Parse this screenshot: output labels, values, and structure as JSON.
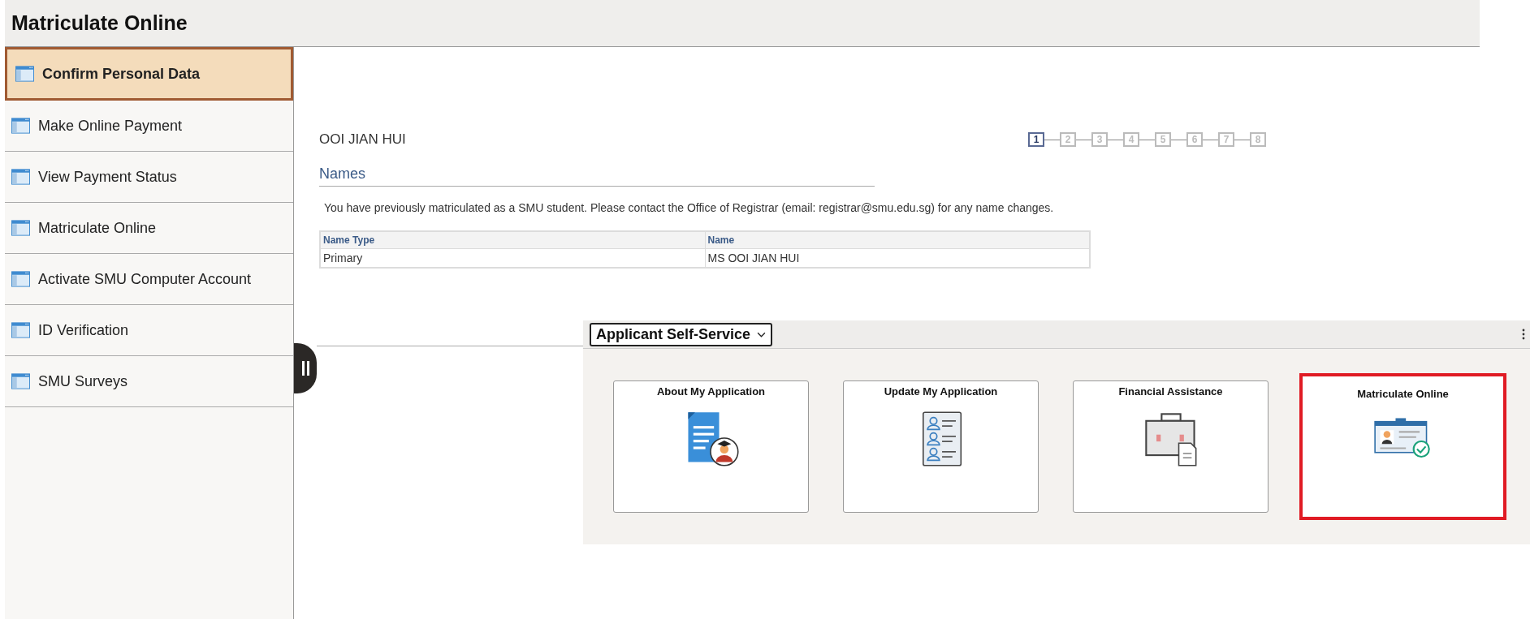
{
  "header": {
    "title": "Matriculate Online"
  },
  "sidebar": {
    "items": [
      {
        "label": "Confirm Personal Data",
        "selected": true
      },
      {
        "label": "Make Online Payment",
        "selected": false
      },
      {
        "label": "View Payment Status",
        "selected": false
      },
      {
        "label": "Matriculate Online",
        "selected": false
      },
      {
        "label": "Activate SMU Computer Account",
        "selected": false
      },
      {
        "label": "ID Verification",
        "selected": false
      },
      {
        "label": "SMU Surveys",
        "selected": false
      }
    ]
  },
  "student_name": "OOI JIAN HUI",
  "steps": [
    {
      "label": "1",
      "selected": true
    },
    {
      "label": "2",
      "selected": false
    },
    {
      "label": "3",
      "selected": false
    },
    {
      "label": "4",
      "selected": false
    },
    {
      "label": "5",
      "selected": false
    },
    {
      "label": "6",
      "selected": false
    },
    {
      "label": "7",
      "selected": false
    },
    {
      "label": "8",
      "selected": false
    }
  ],
  "section_title": "Names",
  "notice": "You have previously matriculated as a SMU student.  Please contact the Office of Registrar (email: registrar@smu.edu.sg) for any name changes.",
  "table": {
    "columns": [
      "Name Type",
      "Name"
    ],
    "rows": [
      [
        "Primary",
        "MS OOI JIAN HUI"
      ]
    ]
  },
  "tile_panel": {
    "title": "Applicant Self-Service",
    "tiles": [
      {
        "title": "About My Application",
        "kind": "document",
        "highlighted": false
      },
      {
        "title": "Update My Application",
        "kind": "people",
        "highlighted": false
      },
      {
        "title": "Financial Assistance",
        "kind": "briefcase",
        "highlighted": false
      },
      {
        "title": "Matriculate Online",
        "kind": "idcard",
        "highlighted": true
      }
    ]
  }
}
